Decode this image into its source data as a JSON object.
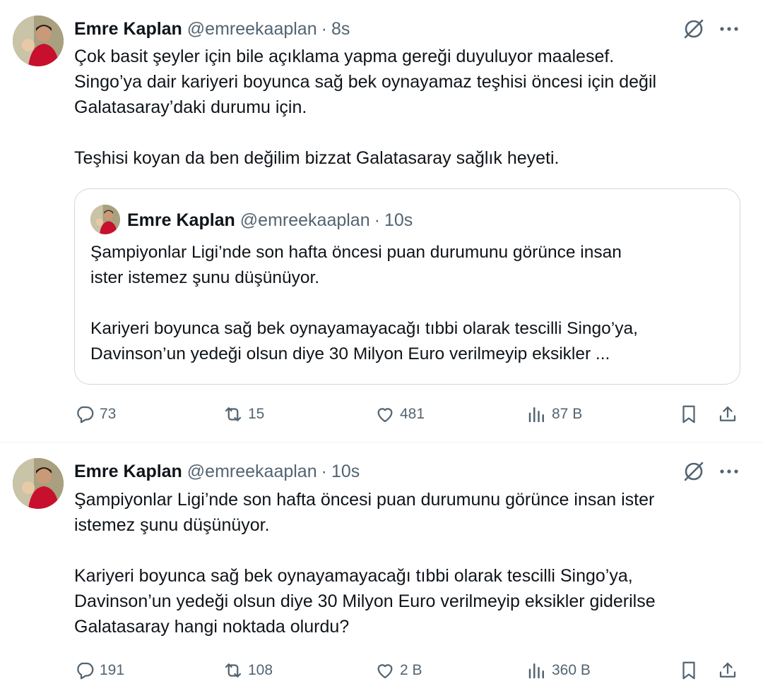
{
  "tweets": [
    {
      "author": {
        "name": "Emre Kaplan",
        "handle": "@emreekaaplan"
      },
      "separator": "·",
      "time": "8s",
      "text": "Çok basit şeyler için bile açıklama yapma gereği duyuluyor maalesef.\nSingo’ya dair kariyeri boyunca sağ bek oynayamaz teşhisi öncesi için değil\nGalatasaray’daki durumu için.\n\nTeşhisi koyan da ben değilim bizzat Galatasaray sağlık heyeti.",
      "quote": {
        "author": {
          "name": "Emre Kaplan",
          "handle": "@emreekaaplan"
        },
        "separator": "·",
        "time": "10s",
        "text": "Şampiyonlar Ligi’nde son hafta öncesi puan durumunu görünce insan\nister istemez şunu düşünüyor.\n\nKariyeri boyunca sağ bek oynayamayacağı tıbbi olarak tescilli Singo’ya,\nDavinson’un yedeği olsun diye 30 Milyon Euro verilmeyip eksikler ..."
      },
      "stats": {
        "replies": "73",
        "reposts": "15",
        "likes": "481",
        "views": "87 B"
      }
    },
    {
      "author": {
        "name": "Emre Kaplan",
        "handle": "@emreekaaplan"
      },
      "separator": "·",
      "time": "10s",
      "text": "Şampiyonlar Ligi’nde son hafta öncesi puan durumunu görünce insan ister\nistemez şunu düşünüyor.\n\nKariyeri boyunca sağ bek oynayamayacağı tıbbi olarak tescilli Singo’ya,\nDavinson’un yedeği olsun diye 30 Milyon Euro verilmeyip eksikler giderilse\nGalatasaray hangi noktada olurdu?",
      "stats": {
        "replies": "191",
        "reposts": "108",
        "likes": "2 B",
        "views": "360 B"
      }
    }
  ],
  "icons": {
    "grok": "grok-icon",
    "more": "more-icon",
    "reply": "reply-icon",
    "repost": "repost-icon",
    "like": "like-icon",
    "views": "views-icon",
    "bookmark": "bookmark-icon",
    "share": "share-icon"
  },
  "colors": {
    "text": "#0f1419",
    "secondary": "#536471",
    "border": "#cfd9de",
    "divider": "#eff3f4",
    "avatar_shirt": "#c8102e"
  }
}
